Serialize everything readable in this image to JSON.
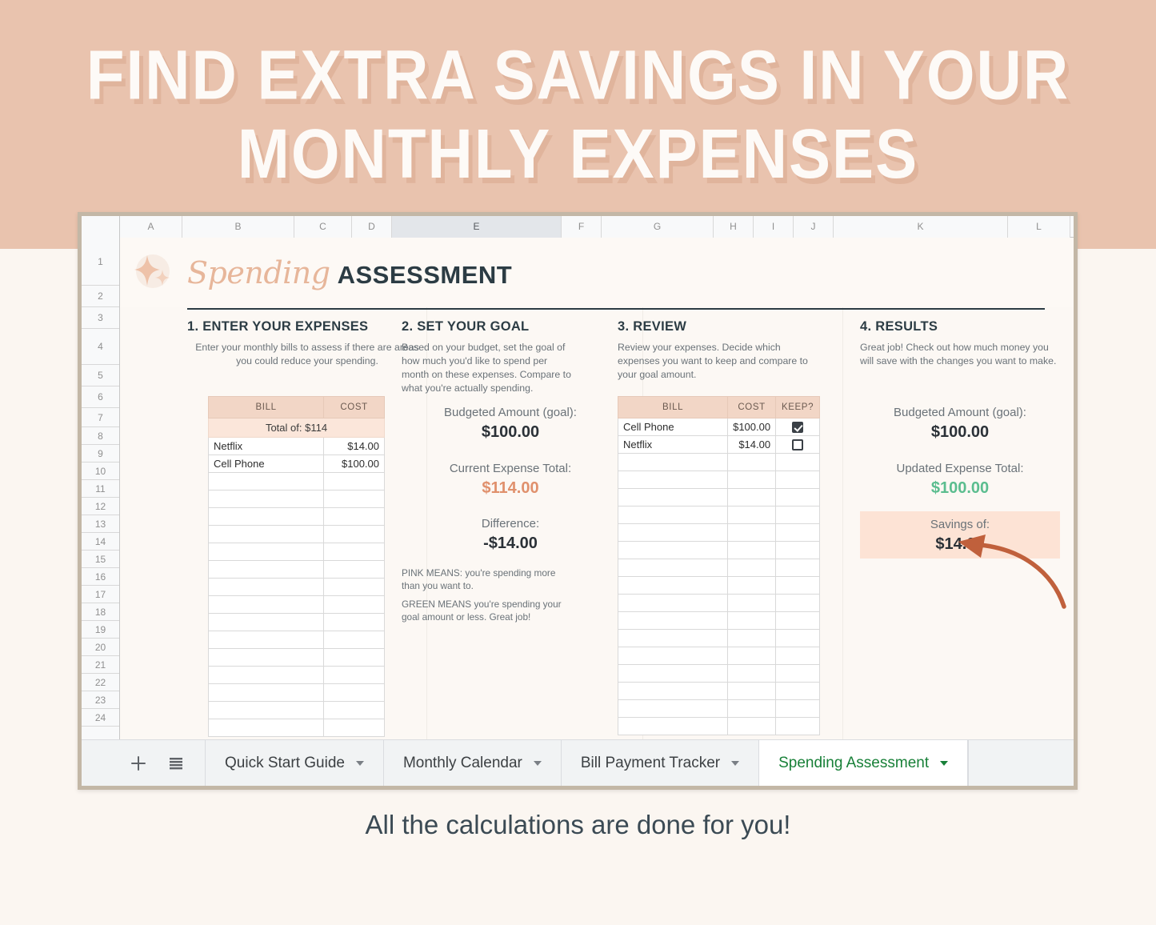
{
  "hero": {
    "title_line1": "FIND EXTRA SAVINGS IN YOUR",
    "title_line2": "MONTHLY EXPENSES"
  },
  "caption": "All the calculations are done for you!",
  "sheet": {
    "columns": [
      "A",
      "B",
      "C",
      "D",
      "E",
      "F",
      "G",
      "H",
      "I",
      "J",
      "K",
      "L"
    ],
    "selected_column": "E",
    "rows": [
      "1",
      "2",
      "3",
      "4",
      "5",
      "6",
      "7",
      "8",
      "9",
      "10",
      "11",
      "12",
      "13",
      "14",
      "15",
      "16",
      "17",
      "18",
      "19",
      "20",
      "21",
      "22",
      "23",
      "24"
    ],
    "header": {
      "script_word": "Spending",
      "bold_word": "ASSESSMENT",
      "sparkle_icon": "sparkle-icon"
    }
  },
  "sections": {
    "enter_expenses": {
      "title": "1. ENTER YOUR EXPENSES",
      "body": "Enter your monthly bills to assess if there are areas you could reduce your spending.",
      "table": {
        "headers": [
          "BILL",
          "COST"
        ],
        "total_row": "Total of: $114",
        "rows": [
          {
            "bill": "Netflix",
            "cost": "$14.00"
          },
          {
            "bill": "Cell Phone",
            "cost": "$100.00"
          }
        ],
        "empty_row_count": 15
      }
    },
    "set_goal": {
      "title": "2. SET YOUR GOAL",
      "body": "Based on your budget, set the goal of how much you'd like to spend per month on these expenses. Compare to what you're actually spending.",
      "budgeted_label": "Budgeted Amount (goal):",
      "budgeted_value": "$100.00",
      "current_label": "Current Expense Total:",
      "current_value": "$114.00",
      "difference_label": "Difference:",
      "difference_value": "-$14.00",
      "legend_pink": "PINK MEANS: you're spending more than you want to.",
      "legend_green": "GREEN MEANS you're spending your goal amount or less. Great job!"
    },
    "review": {
      "title": "3. REVIEW",
      "body": "Review your expenses. Decide which expenses you want to keep and compare to your goal amount.",
      "table": {
        "headers": [
          "BILL",
          "COST",
          "KEEP?"
        ],
        "rows": [
          {
            "bill": "Cell Phone",
            "cost": "$100.00",
            "keep": true
          },
          {
            "bill": "Netflix",
            "cost": "$14.00",
            "keep": false
          }
        ],
        "empty_row_count": 16
      }
    },
    "results": {
      "title": "4. RESULTS",
      "body": "Great job! Check out how much money you will save with the changes you want to make.",
      "budgeted_label": "Budgeted Amount (goal):",
      "budgeted_value": "$100.00",
      "updated_label": "Updated Expense Total:",
      "updated_value": "$100.00",
      "savings_label": "Savings of:",
      "savings_value": "$14.00"
    }
  },
  "tabbar": {
    "add_icon": "plus-icon",
    "list_icon": "all-sheets-icon",
    "tabs": [
      {
        "label": "Quick Start Guide",
        "active": false
      },
      {
        "label": "Monthly Calendar",
        "active": false
      },
      {
        "label": "Bill Payment Tracker",
        "active": false
      },
      {
        "label": "Spending Assessment",
        "active": true
      }
    ]
  },
  "colors": {
    "hero_bg": "#e9c3ae",
    "page_bg": "#fbf6f1",
    "accent_pink": "#f2d6c6",
    "accent_peach": "#fde3d5",
    "text_dark": "#2c3c44",
    "value_pink": "#e0906c",
    "value_green": "#5bbd8f",
    "active_tab_green": "#188038",
    "arrow": "#c0603c"
  }
}
